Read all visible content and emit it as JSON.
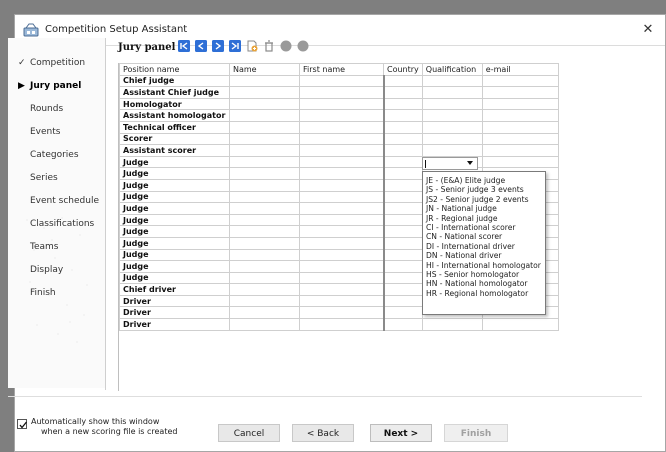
{
  "window": {
    "title": "Competition Setup Assistant",
    "close_glyph": "✕",
    "app_icon": "competition-app-icon"
  },
  "sidebar": {
    "items": [
      {
        "label": "Competition",
        "mark": "✓",
        "state": "done"
      },
      {
        "label": "Jury panel",
        "mark": "▶",
        "state": "active"
      },
      {
        "label": "Rounds",
        "mark": "",
        "state": "pending"
      },
      {
        "label": "Events",
        "mark": "",
        "state": "pending"
      },
      {
        "label": "Categories",
        "mark": "",
        "state": "pending"
      },
      {
        "label": "Series",
        "mark": "",
        "state": "pending"
      },
      {
        "label": "Event schedule",
        "mark": "",
        "state": "pending"
      },
      {
        "label": "Classifications",
        "mark": "",
        "state": "pending"
      },
      {
        "label": "Teams",
        "mark": "",
        "state": "pending"
      },
      {
        "label": "Display",
        "mark": "",
        "state": "pending"
      },
      {
        "label": "Finish",
        "mark": "",
        "state": "pending"
      }
    ]
  },
  "panel": {
    "title": "Jury panel",
    "toolbar": [
      {
        "icon": "move-first-icon",
        "color": "#2e6fd6"
      },
      {
        "icon": "move-up-icon",
        "color": "#2e6fd6"
      },
      {
        "icon": "move-down-icon",
        "color": "#2e6fd6"
      },
      {
        "icon": "move-last-icon",
        "color": "#2e6fd6"
      },
      {
        "icon": "add-document-icon",
        "color": "#e8a33a"
      },
      {
        "icon": "delete-trash-icon",
        "color": "#8a8a8a"
      },
      {
        "icon": "disabled-circle-icon",
        "color": "#9a9a9a"
      },
      {
        "icon": "disabled-circle-icon",
        "color": "#9a9a9a"
      }
    ]
  },
  "grid": {
    "columns": [
      "Position name",
      "Name",
      "First name",
      "Country",
      "Qualification",
      "e-mail"
    ],
    "rows": [
      "Chief judge",
      "Assistant Chief judge",
      "Homologator",
      "Assistant homologator",
      "Technical officer",
      "Scorer",
      "Assistant scorer",
      "Judge",
      "Judge",
      "Judge",
      "Judge",
      "Judge",
      "Judge",
      "Judge",
      "Judge",
      "Judge",
      "Judge",
      "Judge",
      "Chief driver",
      "Driver",
      "Driver",
      "Driver"
    ]
  },
  "qualification_dropdown": {
    "selected": "",
    "options": [
      "JE - (E&A) Elite judge",
      "JS - Senior judge 3 events",
      "JS2 - Senior judge 2 events",
      "JN - National judge",
      "JR - Regional judge",
      "CI -  International scorer",
      "CN - National scorer",
      "DI - International driver",
      "DN - National driver",
      "HI - International homologator",
      "HS - Senior homologator",
      "HN - National homologator",
      "HR - Regional homologator"
    ]
  },
  "footer": {
    "auto_show_line1": "Automatically show this window",
    "auto_show_line2": "when a new scoring file is created",
    "auto_show_checked": true,
    "cancel_label": "Cancel",
    "back_label": "< Back",
    "next_label": "Next >",
    "finish_label": "Finish"
  }
}
